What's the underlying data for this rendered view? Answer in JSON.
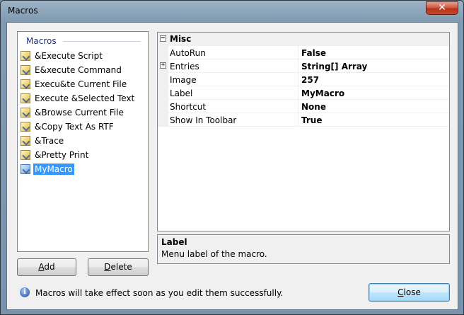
{
  "window": {
    "title": "Macros",
    "close_glyph": "✕"
  },
  "list": {
    "header": "Macros",
    "items": [
      {
        "label": "&Execute Script",
        "icon": "macro-icon"
      },
      {
        "label": "E&xecute Command",
        "icon": "macro-icon"
      },
      {
        "label": "Execu&te Current File",
        "icon": "macro-icon"
      },
      {
        "label": "Execute &Selected Text",
        "icon": "macro-icon"
      },
      {
        "label": "&Browse Current File",
        "icon": "macro-icon"
      },
      {
        "label": "&Copy Text As RTF",
        "icon": "macro-icon"
      },
      {
        "label": "&Trace",
        "icon": "macro-icon"
      },
      {
        "label": "&Pretty Print",
        "icon": "macro-icon"
      },
      {
        "label": "MyMacro",
        "icon": "macro-icon",
        "selected": true
      }
    ]
  },
  "buttons": {
    "add_accel": "A",
    "add_rest": "dd",
    "delete_accel": "D",
    "delete_rest": "elete",
    "close_accel": "C",
    "close_rest": "lose"
  },
  "grid": {
    "category": {
      "expander": "−",
      "label": "Misc"
    },
    "rows": [
      {
        "name": "AutoRun",
        "value": "False"
      },
      {
        "name": "Entries",
        "value": "String[] Array",
        "expander": "+"
      },
      {
        "name": "Image",
        "value": "257"
      },
      {
        "name": "Label",
        "value": "MyMacro"
      },
      {
        "name": "Shortcut",
        "value": "None"
      },
      {
        "name": "Show In Toolbar",
        "value": "True"
      }
    ]
  },
  "help": {
    "title": "Label",
    "description": "Menu label of the macro."
  },
  "status": {
    "icon": "info-icon",
    "glyph": "i",
    "text": "Macros will take effect soon as you edit them successfully."
  }
}
